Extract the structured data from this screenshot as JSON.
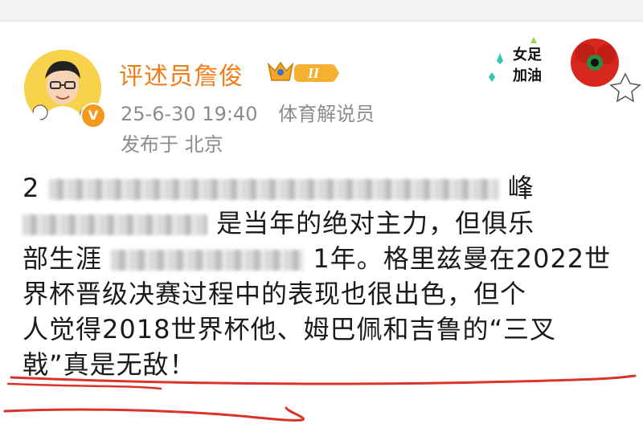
{
  "author": {
    "name": "评述员詹俊",
    "verified_badge": "V",
    "level_badge": "II",
    "avatar_icon": "avatar-cartoon-icon"
  },
  "meta": {
    "datetime": "25-6-30 19:40",
    "role": "体育解说员",
    "location": "发布于 北京"
  },
  "sticker": {
    "line1": "女足",
    "line2": "加油"
  },
  "post": {
    "line1_start": "2",
    "line1_end": "峰",
    "line2_mid": "是当年的绝对主力，但俱乐",
    "line3_start": "部生涯",
    "line3_end": "1年。格里兹曼在2022世",
    "line4": "界杯晋级决赛过程中的表现也很出色，但个",
    "line5": "人觉得2018世界杯他、姆巴佩和吉鲁的“三叉",
    "line6": "戟”真是无敌！"
  },
  "colors": {
    "username": "#f27b1a",
    "meta": "#8c8c8c",
    "underline": "#d9332b"
  }
}
